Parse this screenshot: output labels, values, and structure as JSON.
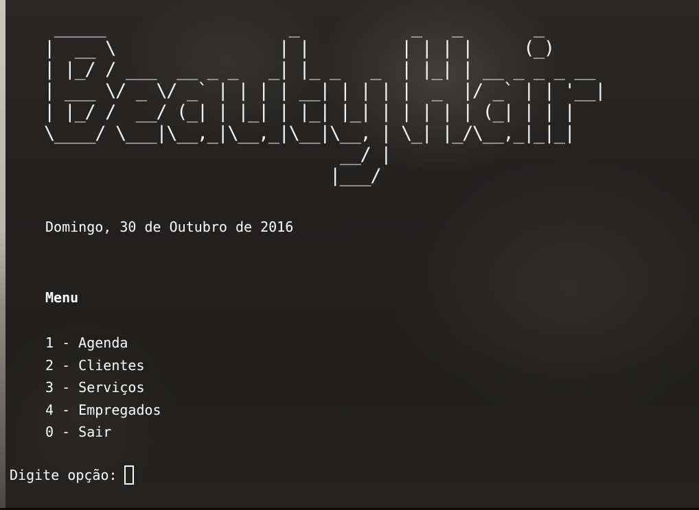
{
  "banner": {
    "ascii_art": " _____                  _           _   _       _      \n|  __ \\                | |         | | | |     (_)     \n| |_/ / ___  __ _ _   _| |_ _   _  | |_| | __ _ _ _ __ \n| ___ \\/ _ \\/ _` | | | | __| | | | |  _  |/ _` | | '__|\n| |_/ /  __/ (_| | |_| | |_| |_| | | | | | (_| | | |   \n\\____/ \\___|\\__,_|\\__,_|\\__|\\__, | \\_| |_/\\__,_|_|_|   \n                             __/ |                      \n                            |___/                       "
  },
  "date_line": "Domingo, 30 de Outubro de 2016",
  "menu": {
    "title": "Menu",
    "items": [
      {
        "label": "1 - Agenda"
      },
      {
        "label": "2 - Clientes"
      },
      {
        "label": "3 - Serviços"
      },
      {
        "label": "4 - Empregados"
      },
      {
        "label": "0 - Sair"
      }
    ]
  },
  "prompt": {
    "label": "Digite opção:",
    "value": ""
  },
  "colors": {
    "text": "#ffffff",
    "background": "#1f1e1c",
    "left_strip": "#c9c6bf"
  }
}
